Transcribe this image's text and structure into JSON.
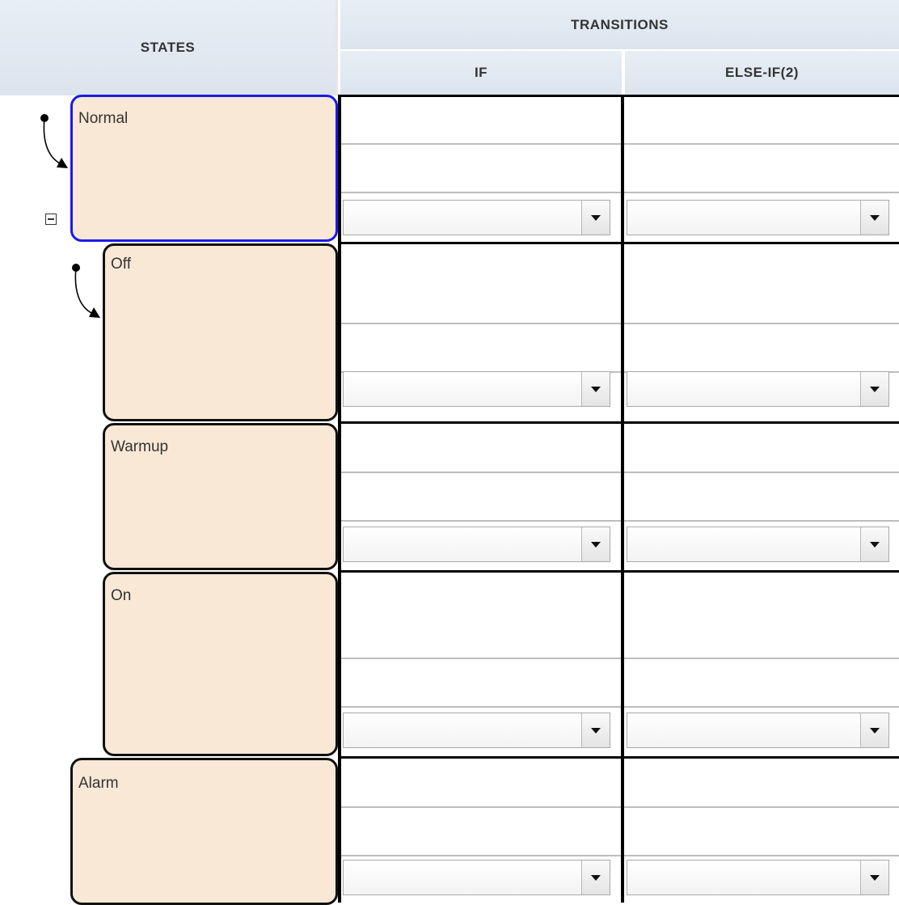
{
  "headers": {
    "states": "STATES",
    "transitions": "TRANSITIONS",
    "if": "IF",
    "else_if": "ELSE-IF(2)"
  },
  "states": [
    {
      "name": "Normal",
      "selected": true,
      "default_transition": true,
      "collapsible": true
    },
    {
      "name": "Off",
      "selected": false,
      "default_transition": true
    },
    {
      "name": "Warmup",
      "selected": false
    },
    {
      "name": "On",
      "selected": false
    },
    {
      "name": "Alarm",
      "selected": false
    }
  ],
  "transition_cells": {
    "if_dropdown_value": "",
    "else_if_dropdown_value": ""
  },
  "colors": {
    "state_fill": "#f9e8d5",
    "selected_border": "#1a1ae6",
    "header_bg": "#dbe4ee"
  }
}
